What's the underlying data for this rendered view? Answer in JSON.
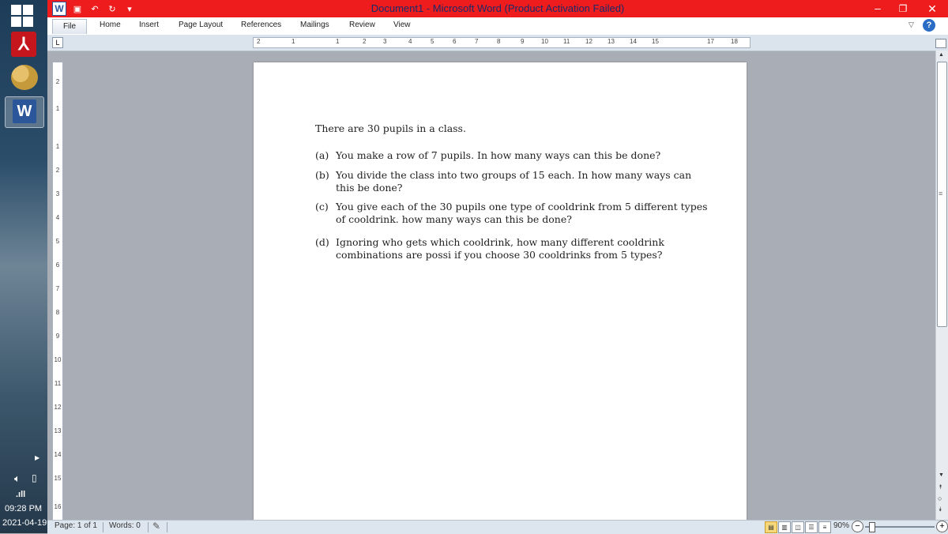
{
  "taskbar": {
    "clock_time": "09:28 PM",
    "clock_date": "2021-04-19",
    "icons": [
      "windows-logo-icon",
      "acrobat-icon",
      "paint-icon",
      "word-icon",
      "speaker-icon",
      "network-icon",
      "signal-icon"
    ]
  },
  "window": {
    "title": "Document1 - Microsoft Word (Product Activation Failed)",
    "title_bar_color": "#ee1c1c",
    "title_text_color": "#1b2a6b",
    "word_logo": "W"
  },
  "ribbon": {
    "tabs": [
      "File",
      "Home",
      "Insert",
      "Page Layout",
      "References",
      "Mailings",
      "Review",
      "View"
    ],
    "help_label": "?"
  },
  "ruler": {
    "tab_selector": "L",
    "h_ticks": [
      "2",
      "1",
      "1",
      "2",
      "3",
      "4",
      "5",
      "6",
      "7",
      "8",
      "9",
      "10",
      "11",
      "12",
      "13",
      "14",
      "15",
      "17",
      "18"
    ],
    "v_ticks": [
      "2",
      "1",
      "1",
      "2",
      "3",
      "4",
      "5",
      "6",
      "7",
      "8",
      "9",
      "10",
      "11",
      "12",
      "13",
      "14",
      "15",
      "16"
    ]
  },
  "document": {
    "intro": "There are 30 pupils in a class.",
    "questions": [
      {
        "label": "(a)",
        "text": "You make a row of 7 pupils. In how many ways can this be done?"
      },
      {
        "label": "(b)",
        "text": "You divide the class into two groups of 15 each. In how many ways can this be done?"
      },
      {
        "label": "(c)",
        "text": "You give each of the 30 pupils one type of cooldrink from 5 different types of cooldrink. how many ways can this be done?"
      },
      {
        "label": "(d)",
        "text": "Ignoring who gets which cooldrink, how many different cooldrink combinations are possi if you choose 30 cooldrinks from 5 types?"
      }
    ]
  },
  "statusbar": {
    "page": "Page: 1 of 1",
    "words": "Words: 0",
    "zoom": "90%",
    "zoom_fraction": 0.9
  }
}
